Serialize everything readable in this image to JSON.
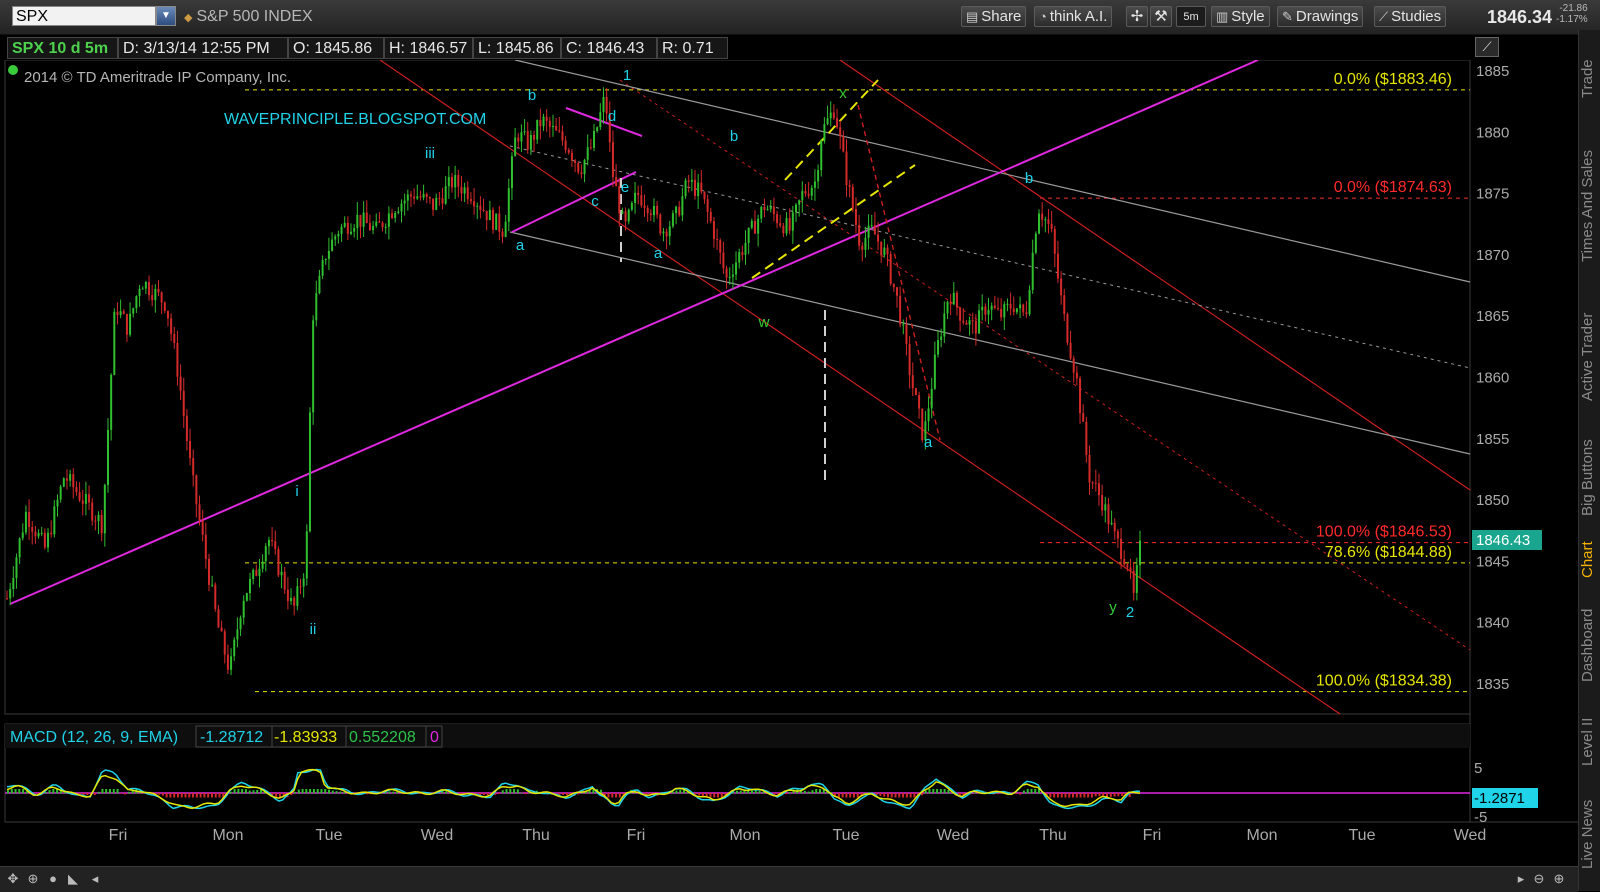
{
  "toolbar": {
    "symbol": "SPX",
    "symbol_name": "S&P 500 INDEX",
    "share": "Share",
    "think_ai": "think A.I.",
    "timeframe": "5m",
    "style": "Style",
    "drawings": "Drawings",
    "studies": "Studies",
    "last_price": "1846.34",
    "change": "-21.86",
    "change_pct": "-1.17%"
  },
  "info": {
    "title": "SPX 10 d 5m",
    "date": "D: 3/13/14 12:55 PM",
    "open": "O: 1845.86",
    "high": "H: 1846.57",
    "low": "L: 1845.86",
    "close": "C: 1846.43",
    "range": "R: 0.71"
  },
  "chart_data": {
    "type": "candlestick",
    "copyright": "2014 © TD Ameritrade IP Company, Inc.",
    "watermark": "WAVEPRINCIPLE.BLOGSPOT.COM",
    "y_ticks": [
      "1885",
      "1880",
      "1875",
      "1870",
      "1865",
      "1860",
      "1855",
      "1850",
      "1845",
      "1840",
      "1835"
    ],
    "ylim": [
      1833,
      1886
    ],
    "x_ticks": [
      "Fri",
      "Mon",
      "Tue",
      "Wed",
      "Thu",
      "Fri",
      "Mon",
      "Tue",
      "Wed",
      "Thu",
      "Fri",
      "Mon",
      "Tue",
      "Wed"
    ],
    "current_price": "1846.43",
    "price_path": [
      [
        0,
        1842
      ],
      [
        3,
        1849
      ],
      [
        6,
        1846
      ],
      [
        9,
        1852
      ],
      [
        12,
        1850
      ],
      [
        15,
        1848
      ],
      [
        17,
        1866
      ],
      [
        19,
        1864
      ],
      [
        21,
        1868
      ],
      [
        23,
        1867
      ],
      [
        25,
        1866
      ],
      [
        27,
        1860
      ],
      [
        29,
        1852
      ],
      [
        31,
        1846
      ],
      [
        33,
        1840
      ],
      [
        35,
        1836
      ],
      [
        37,
        1842
      ],
      [
        39,
        1844
      ],
      [
        41,
        1847
      ],
      [
        43,
        1844
      ],
      [
        45,
        1841
      ],
      [
        47,
        1845
      ],
      [
        48,
        1865
      ],
      [
        50,
        1870
      ],
      [
        52,
        1872
      ],
      [
        55,
        1873
      ],
      [
        58,
        1872
      ],
      [
        61,
        1874
      ],
      [
        64,
        1875
      ],
      [
        67,
        1874
      ],
      [
        70,
        1876
      ],
      [
        73,
        1875
      ],
      [
        76,
        1873
      ],
      [
        78,
        1872
      ],
      [
        80,
        1880
      ],
      [
        82,
        1879
      ],
      [
        84,
        1881
      ],
      [
        86,
        1880
      ],
      [
        88,
        1879
      ],
      [
        90,
        1877
      ],
      [
        92,
        1879
      ],
      [
        94,
        1883
      ],
      [
        95,
        1877
      ],
      [
        97,
        1872
      ],
      [
        99,
        1875
      ],
      [
        101,
        1874
      ],
      [
        103,
        1872
      ],
      [
        105,
        1873
      ],
      [
        107,
        1876
      ],
      [
        109,
        1875
      ],
      [
        111,
        1872
      ],
      [
        113,
        1868
      ],
      [
        115,
        1870
      ],
      [
        117,
        1872
      ],
      [
        119,
        1874
      ],
      [
        121,
        1873
      ],
      [
        123,
        1872
      ],
      [
        125,
        1875
      ],
      [
        127,
        1876
      ],
      [
        128,
        1880
      ],
      [
        130,
        1882
      ],
      [
        132,
        1876
      ],
      [
        134,
        1871
      ],
      [
        136,
        1872
      ],
      [
        138,
        1870
      ],
      [
        140,
        1866
      ],
      [
        142,
        1860
      ],
      [
        144,
        1855
      ],
      [
        146,
        1862
      ],
      [
        148,
        1867
      ],
      [
        150,
        1865
      ],
      [
        152,
        1864
      ],
      [
        154,
        1866
      ],
      [
        156,
        1865
      ],
      [
        158,
        1866
      ],
      [
        160,
        1865
      ],
      [
        162,
        1874
      ],
      [
        164,
        1872
      ],
      [
        166,
        1865
      ],
      [
        168,
        1860
      ],
      [
        170,
        1852
      ],
      [
        172,
        1850
      ],
      [
        174,
        1847
      ],
      [
        176,
        1845
      ],
      [
        177,
        1842
      ],
      [
        178,
        1846
      ]
    ],
    "fib_levels": [
      {
        "label": "0.0%  ($1883.46)",
        "value": 1883.46,
        "color": "#e6e600"
      },
      {
        "label": "0.0%  ($1874.63)",
        "value": 1874.63,
        "color": "#ff2a2a"
      },
      {
        "label": "100.0%  ($1846.53)",
        "value": 1846.53,
        "color": "#ff2a2a"
      },
      {
        "label": "78.6%  ($1844.88)",
        "value": 1844.88,
        "color": "#e6e600"
      },
      {
        "label": "100.0%  ($1834.38)",
        "value": 1834.38,
        "color": "#e6e600"
      }
    ],
    "wave_labels": [
      {
        "t": "i",
        "x": 297,
        "y": 496,
        "c": "#1fd3e8"
      },
      {
        "t": "ii",
        "x": 313,
        "y": 634,
        "c": "#1fd3e8"
      },
      {
        "t": "iii",
        "x": 430,
        "y": 158,
        "c": "#1fd3e8"
      },
      {
        "t": "a",
        "x": 520,
        "y": 250,
        "c": "#1fd3e8"
      },
      {
        "t": "b",
        "x": 532,
        "y": 100,
        "c": "#1fd3e8"
      },
      {
        "t": "c",
        "x": 595,
        "y": 206,
        "c": "#1fd3e8"
      },
      {
        "t": "d",
        "x": 612,
        "y": 121,
        "c": "#1fd3e8"
      },
      {
        "t": "e",
        "x": 625,
        "y": 192,
        "c": "#1fd3e8"
      },
      {
        "t": "1",
        "x": 627,
        "y": 80,
        "c": "#1fd3e8"
      },
      {
        "t": "a",
        "x": 658,
        "y": 258,
        "c": "#1fd3e8"
      },
      {
        "t": "b",
        "x": 734,
        "y": 141,
        "c": "#1fd3e8"
      },
      {
        "t": "w",
        "x": 764,
        "y": 327,
        "c": "#33cc33"
      },
      {
        "t": "x",
        "x": 843,
        "y": 98,
        "c": "#33cc33"
      },
      {
        "t": "a",
        "x": 928,
        "y": 447,
        "c": "#1fd3e8"
      },
      {
        "t": "b",
        "x": 1029,
        "y": 183,
        "c": "#1fd3e8"
      },
      {
        "t": "y",
        "x": 1113,
        "y": 612,
        "c": "#33cc33"
      },
      {
        "t": "2",
        "x": 1130,
        "y": 617,
        "c": "#1fd3e8"
      }
    ]
  },
  "macd": {
    "label": "MACD (12, 26, 9, EMA)",
    "value": "-1.28712",
    "avg": "-1.83933",
    "diff": "0.552208",
    "zero": "0",
    "axis_top": "5",
    "axis_bottom": "-5",
    "current": "-1.2871"
  },
  "side_tabs": [
    "Trade",
    "Times And Sales",
    "Active Trader",
    "Big Buttons",
    "Chart",
    "Dashboard",
    "Level II",
    "Live News"
  ]
}
